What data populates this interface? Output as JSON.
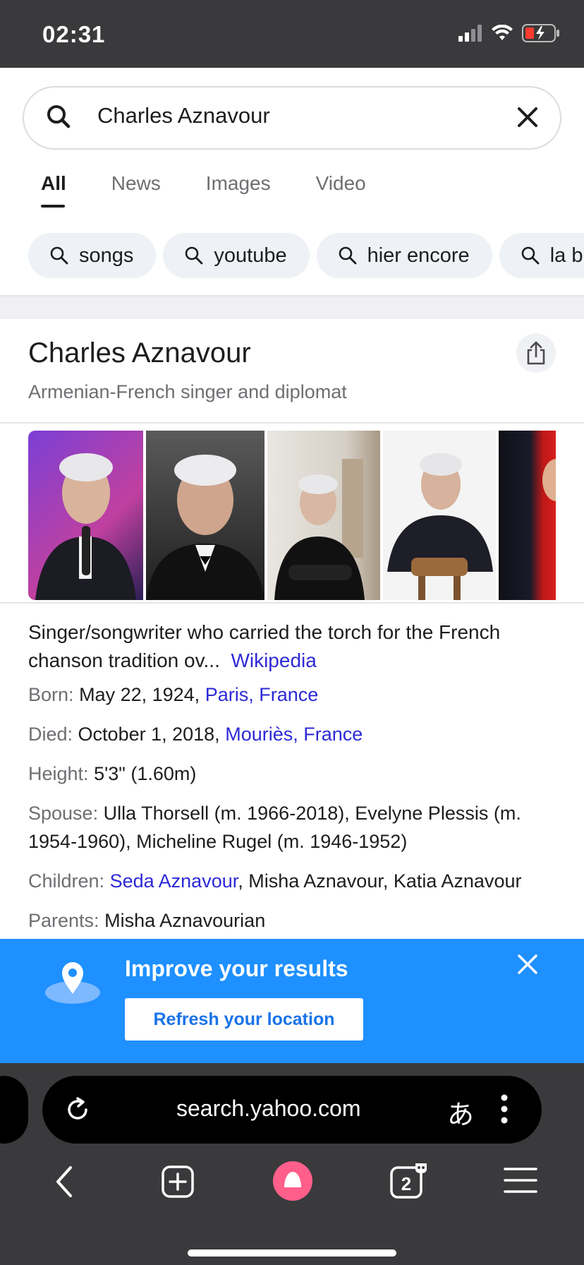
{
  "status_bar": {
    "time": "02:31",
    "icons": [
      "signal-icon",
      "wifi-icon",
      "battery-low-charging-icon"
    ]
  },
  "search": {
    "query": "Charles Aznavour",
    "icons": [
      "search-icon",
      "clear-icon"
    ]
  },
  "tabs": [
    {
      "label": "All",
      "active": true
    },
    {
      "label": "News",
      "active": false
    },
    {
      "label": "Images",
      "active": false
    },
    {
      "label": "Video",
      "active": false
    }
  ],
  "chips": [
    {
      "label": "songs"
    },
    {
      "label": "youtube"
    },
    {
      "label": "hier encore"
    },
    {
      "label": "la b"
    }
  ],
  "knowledge_panel": {
    "title": "Charles Aznavour",
    "subtitle": "Armenian-French singer and diplomat",
    "description": "Singer/songwriter who carried the torch for the French chanson tradition ov...",
    "description_link": "Wikipedia",
    "facts": {
      "born": {
        "label": "Born:",
        "value": "May 22, 1924,",
        "link": "Paris, France"
      },
      "died": {
        "label": "Died:",
        "value": "October 1, 2018,",
        "link": "Mouriès, France"
      },
      "height": {
        "label": "Height:",
        "value": "5'3\" (1.60m)"
      },
      "spouse": {
        "label": "Spouse:",
        "value": "Ulla Thorsell (m. 1966-2018), Evelyne Plessis (m. 1954-1960), Micheline Rugel (m. 1946-1952)"
      },
      "children": {
        "label": "Children:",
        "link": "Seda Aznavour",
        "value": ", Misha Aznavour, Katia Aznavour"
      },
      "parents": {
        "label": "Parents:",
        "value": "Misha Aznavourian"
      }
    }
  },
  "banner": {
    "title": "Improve your results",
    "button": "Refresh your location"
  },
  "browser": {
    "url": "search.yahoo.com",
    "translate_glyph": "あ",
    "tab_count": "2"
  },
  "colors": {
    "link": "#2d2ad6",
    "banner": "#1e90ff",
    "browser_chrome": "#3a3a3c",
    "assistant_pink": "#ff5f8a"
  }
}
